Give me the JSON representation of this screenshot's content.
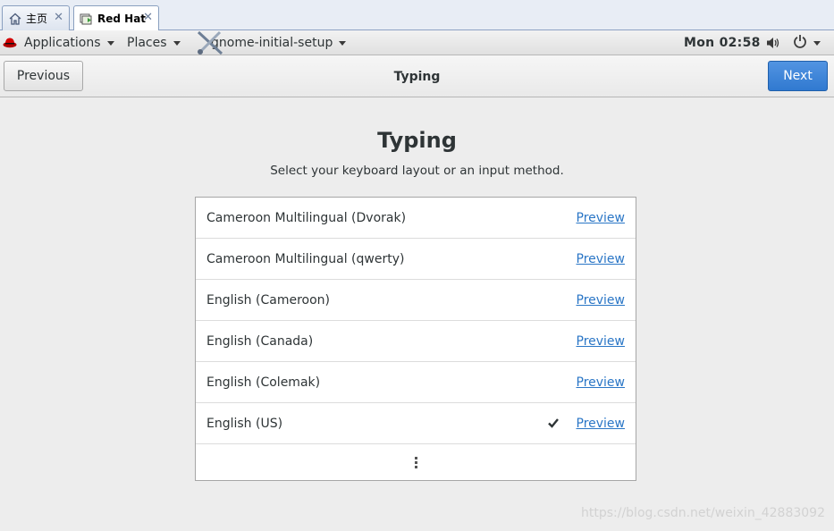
{
  "vm_tabs": [
    {
      "label": "主页",
      "icon": "home-icon"
    },
    {
      "label": "Red Hat",
      "icon": "vm-icon"
    }
  ],
  "tab_close_glyph": "✕",
  "topbar": {
    "applications": "Applications",
    "places": "Places",
    "app_menu": "gnome-initial-setup",
    "clock": "Mon 02:58"
  },
  "header": {
    "previous": "Previous",
    "title": "Typing",
    "next": "Next"
  },
  "page": {
    "title": "Typing",
    "subtitle": "Select your keyboard layout or an input method."
  },
  "layouts": [
    {
      "name": "Cameroon Multilingual (Dvorak)",
      "selected": false,
      "preview": "Preview"
    },
    {
      "name": "Cameroon Multilingual (qwerty)",
      "selected": false,
      "preview": "Preview"
    },
    {
      "name": "English (Cameroon)",
      "selected": false,
      "preview": "Preview"
    },
    {
      "name": "English (Canada)",
      "selected": false,
      "preview": "Preview"
    },
    {
      "name": "English (Colemak)",
      "selected": false,
      "preview": "Preview"
    },
    {
      "name": "English (US)",
      "selected": true,
      "preview": "Preview"
    }
  ],
  "watermark": "https://blog.csdn.net/weixin_42883092",
  "colors": {
    "accent": "#3584e4",
    "link": "#2a76c6",
    "background": "#ededed"
  }
}
